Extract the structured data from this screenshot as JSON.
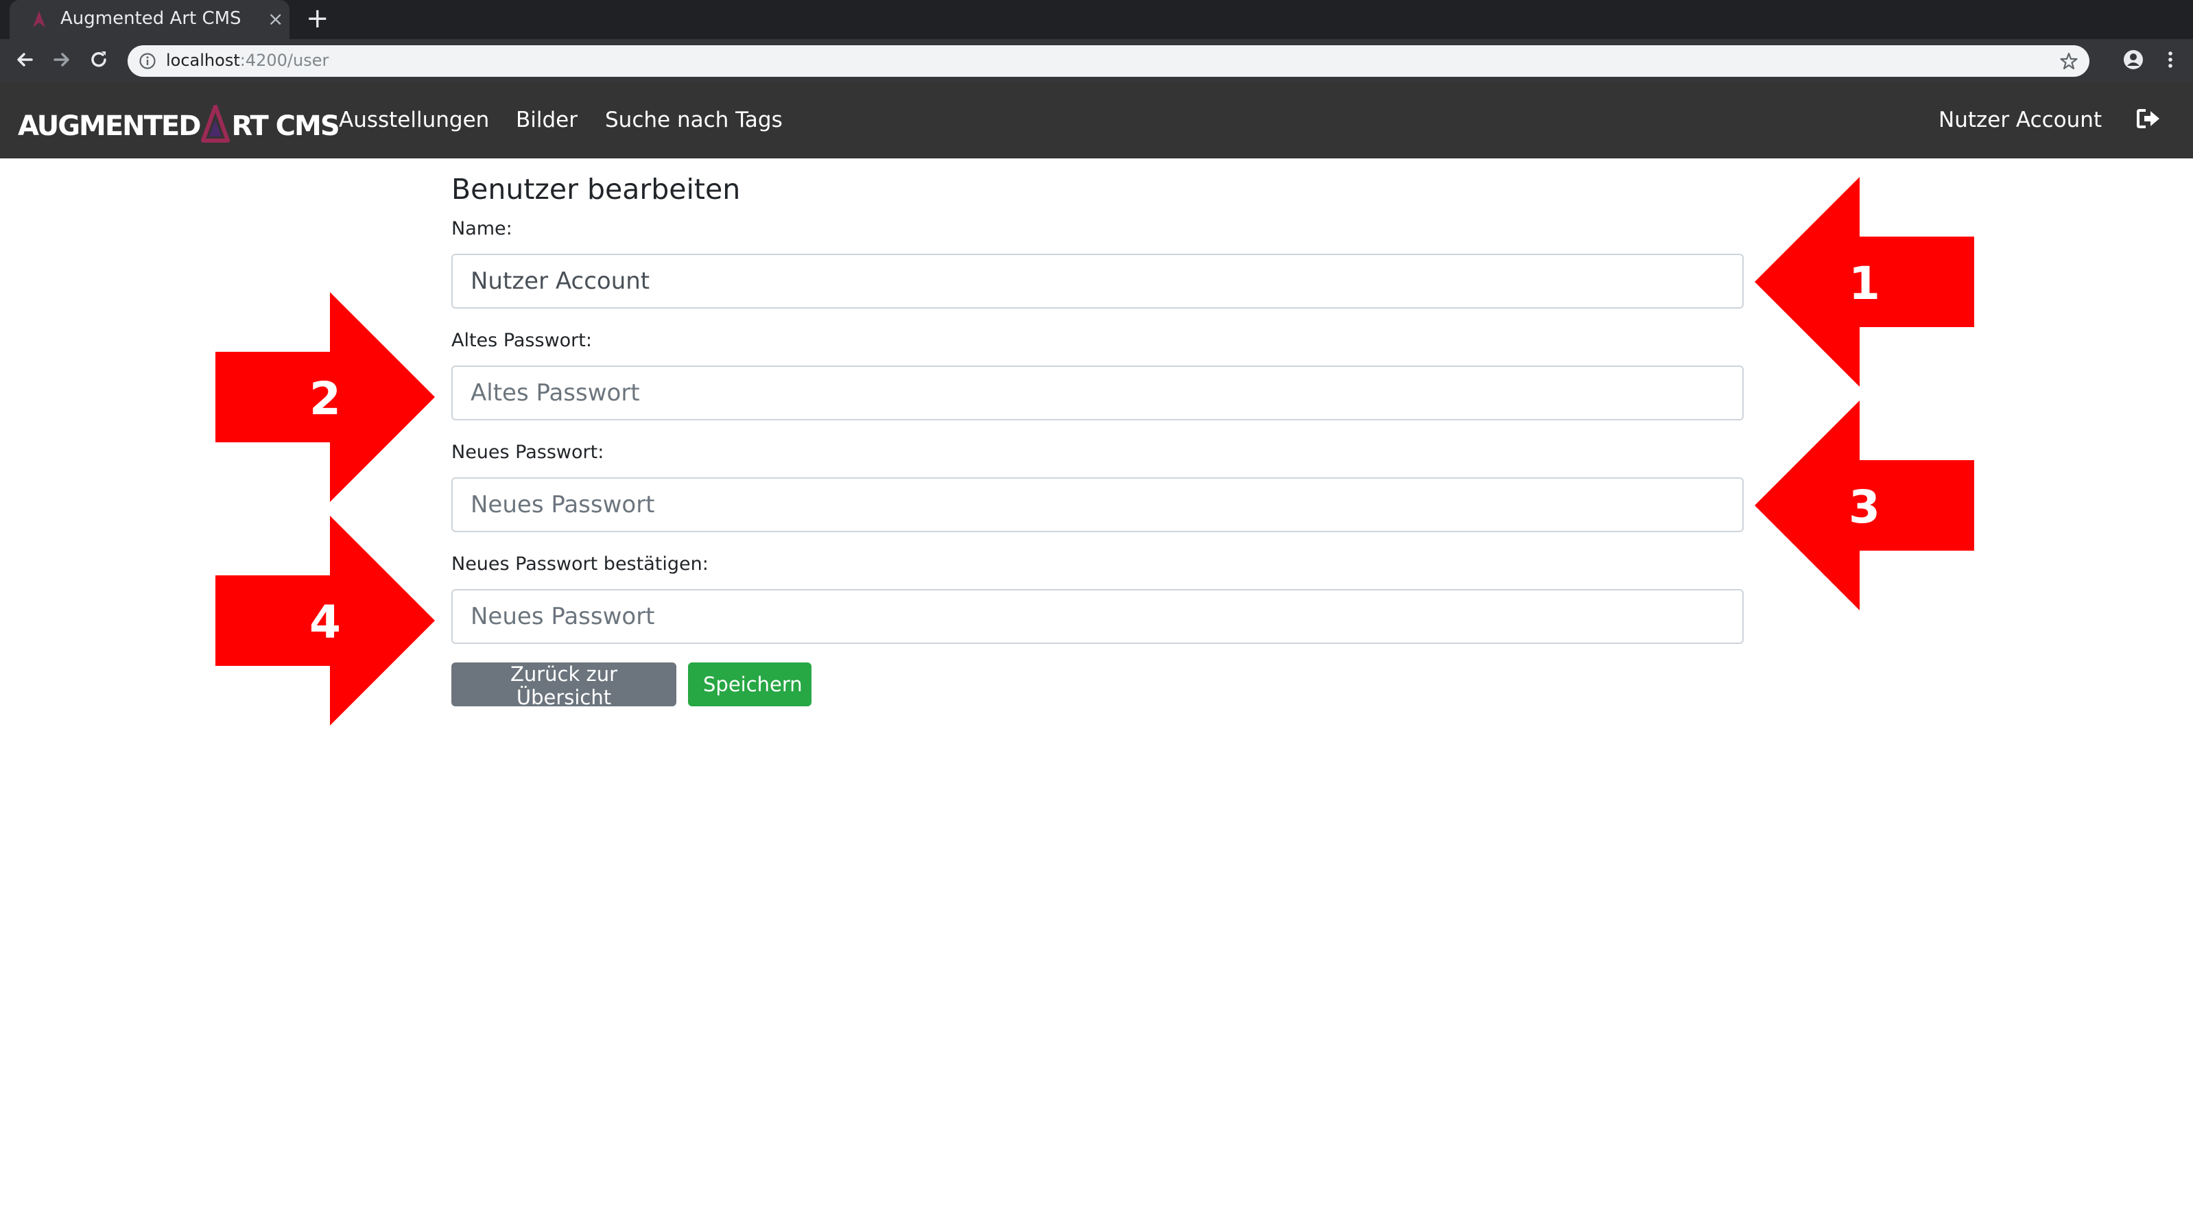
{
  "browser": {
    "tab_title": "Augmented Art CMS",
    "tab_close": "×",
    "new_tab": "+",
    "url_host": "localhost",
    "url_path": ":4200/user"
  },
  "navbar": {
    "brand_left": "AUGMENTED",
    "brand_right": "RT CMS",
    "links": [
      "Ausstellungen",
      "Bilder",
      "Suche nach Tags"
    ],
    "account": "Nutzer Account"
  },
  "form": {
    "title": "Benutzer bearbeiten",
    "name_label": "Name:",
    "name_value": "Nutzer Account",
    "old_pw_label": "Altes Passwort:",
    "old_pw_placeholder": "Altes Passwort",
    "new_pw_label": "Neues Passwort:",
    "new_pw_placeholder": "Neues Passwort",
    "confirm_pw_label": "Neues Passwort bestätigen:",
    "confirm_pw_placeholder": "Neues Passwort",
    "back_button": "Zurück zur Übersicht",
    "save_button": "Speichern"
  },
  "annotations": [
    "1",
    "2",
    "3",
    "4"
  ],
  "colors": {
    "navbar_bg": "#343434",
    "annotation_red": "#ff0000",
    "save_green": "#28a745",
    "back_gray": "#6c757d"
  }
}
